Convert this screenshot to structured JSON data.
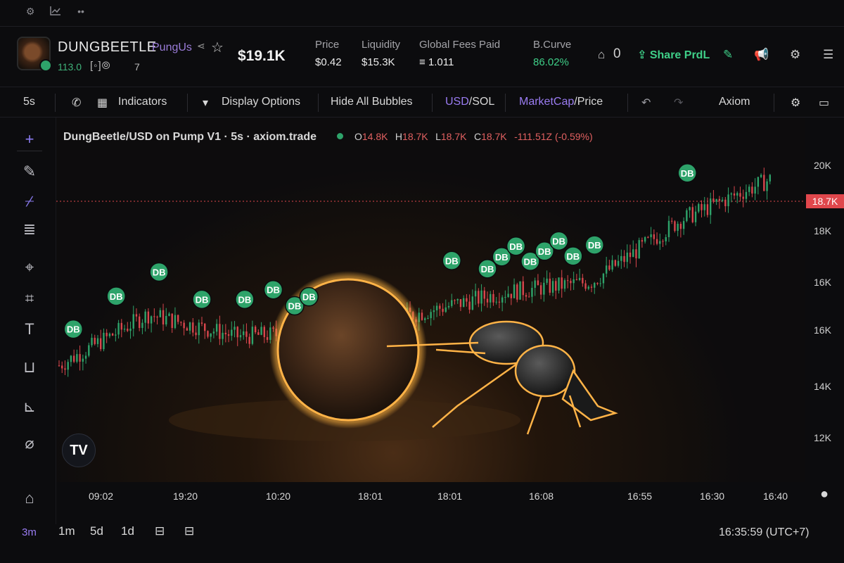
{
  "header": {
    "token_name": "DUNGBEETLE",
    "ticker": "PungUs",
    "sub_age": "113.0",
    "sub_mid": "[◦]⦾",
    "sub_count": "7",
    "market_cap": "$19.1K",
    "stats": [
      {
        "label": "Price",
        "value": "$0.42"
      },
      {
        "label": "Liquidity",
        "value": "$15.3K"
      },
      {
        "label": "Global Fees Paid",
        "value": "≡ 1.011"
      },
      {
        "label": "B.Curve",
        "value": "86.02%"
      }
    ],
    "holders_count": "0",
    "share_label": "Share PrdL"
  },
  "toolbar": {
    "interval": "5s",
    "indicators": "Indicators",
    "display_options": "Display Options",
    "hide_bubbles": "Hide All Bubbles",
    "usd_sol_a": "USD",
    "usd_sol_b": "/SOL",
    "mc_a": "MarketCap",
    "mc_b": "/Price",
    "axiom": "Axiom"
  },
  "legend": {
    "symbol": "DungBeetle/USD on Pump V1 · 5s · axiom.trade",
    "o_label": "O",
    "o": "14.8K",
    "h_label": "H",
    "h": "18.7K",
    "l_label": "L",
    "l": "18.7K",
    "c_label": "C",
    "c": "18.7K",
    "change": "-111.51Z (-0.59%)"
  },
  "price_axis": {
    "ticks": [
      "20K",
      "18K",
      "16K",
      "16K",
      "14K",
      "12K"
    ],
    "current": "18.7K"
  },
  "time_axis": [
    "09:02",
    "19:20",
    "10:20",
    "18:01",
    "18:01",
    "16:08",
    "16:55",
    "16:30",
    "16:40"
  ],
  "bubble_label": "DB",
  "bottom": {
    "ranges": [
      "3m",
      "1m",
      "5d",
      "1d"
    ],
    "clock": "16:35:59 (UTC+7)"
  },
  "chart_data": {
    "type": "line",
    "title": "DungBeetle/USD on Pump V1 · 5s · axiom.trade",
    "ylim": [
      11000,
      21000
    ],
    "x": [
      "09:02",
      "19:20",
      "10:20",
      "18:01",
      "18:01",
      "16:08",
      "16:55",
      "16:30",
      "16:40"
    ],
    "series": [
      {
        "values": [
          14200,
          15600,
          15000,
          15100,
          15600,
          16200,
          16500,
          18200,
          19300
        ]
      }
    ],
    "current_price_line": 18700,
    "colors": {
      "up": "#2ea36a",
      "down": "#d9464d",
      "bubble": "#2ea36a"
    }
  }
}
